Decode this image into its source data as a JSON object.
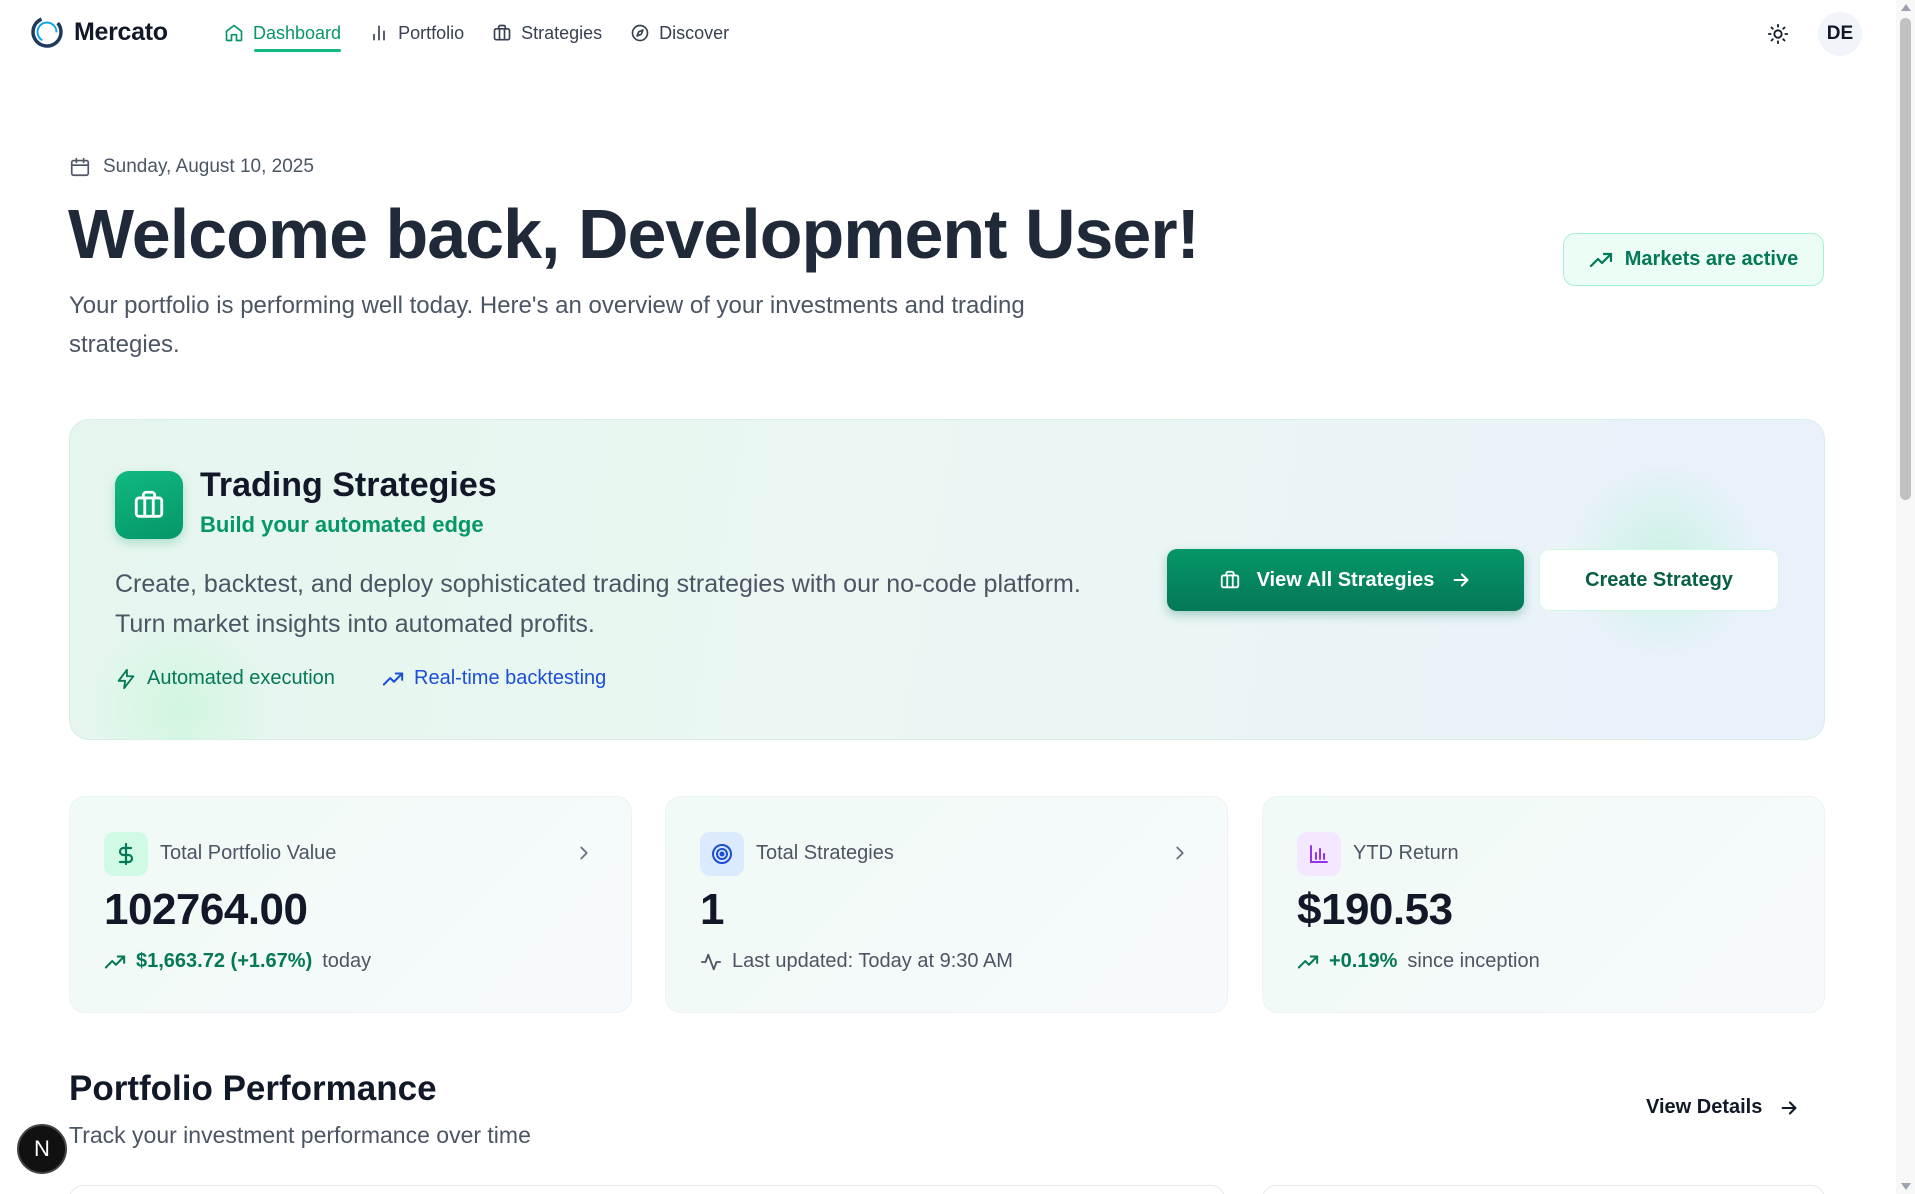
{
  "app": {
    "name": "Mercato"
  },
  "nav": {
    "items": [
      {
        "label": "Dashboard",
        "icon": "home-icon",
        "active": true
      },
      {
        "label": "Portfolio",
        "icon": "bar-chart-icon",
        "active": false
      },
      {
        "label": "Strategies",
        "icon": "briefcase-icon",
        "active": false
      },
      {
        "label": "Discover",
        "icon": "compass-icon",
        "active": false
      }
    ],
    "user_initials": "DE"
  },
  "header": {
    "date": "Sunday, August 10, 2025",
    "welcome": "Welcome back, Development User!",
    "subtitle": "Your portfolio is performing well today. Here's an overview of your investments and trading strategies.",
    "market_status": "Markets are active"
  },
  "banner": {
    "title": "Trading Strategies",
    "subtitle": "Build your automated edge",
    "description": "Create, backtest, and deploy sophisticated trading strategies with our no-code platform. Turn market insights into automated profits.",
    "features": [
      "Automated execution",
      "Real-time backtesting"
    ],
    "primary_button": "View All Strategies",
    "secondary_button": "Create Strategy"
  },
  "stats": [
    {
      "label": "Total Portfolio Value",
      "value": "102764.00",
      "change": "$1,663.72 (+1.67%)",
      "suffix": "today",
      "icon": "dollar-icon"
    },
    {
      "label": "Total Strategies",
      "value": "1",
      "foot": "Last updated: Today at 9:30 AM",
      "icon": "target-icon"
    },
    {
      "label": "YTD Return",
      "value": "$190.53",
      "change": "+0.19%",
      "suffix": "since inception",
      "icon": "bar-chart-icon"
    }
  ],
  "performance": {
    "title": "Portfolio Performance",
    "subtitle": "Track your investment performance over time",
    "view_details": "View Details"
  },
  "dev_badge": "N",
  "colors": {
    "accent": "#059669",
    "accent_dark": "#047857",
    "link_blue": "#1d4ed8",
    "text": "#111827",
    "muted": "#4b5563"
  }
}
